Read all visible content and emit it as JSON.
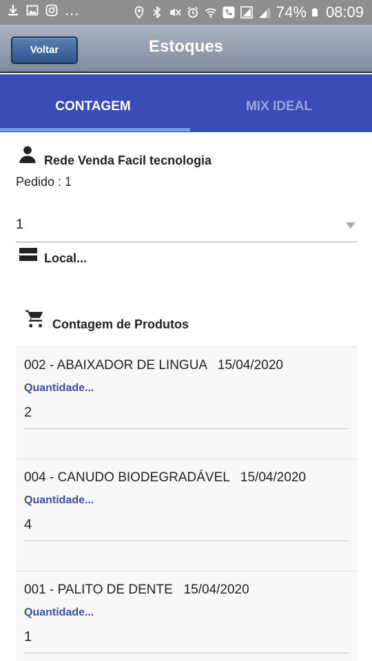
{
  "status_bar": {
    "battery": "74%",
    "time": "08:09",
    "overflow": "...",
    "left_icons": [
      "download-icon",
      "image-icon",
      "instagram-icon"
    ],
    "right_icons": [
      "location-icon",
      "bluetooth-icon",
      "mute-icon",
      "alarm-icon",
      "wifi-icon",
      "call-icon",
      "data-icon",
      "signal-icon",
      "battery-icon"
    ]
  },
  "header": {
    "back_label": "Voltar",
    "title": "Estoques"
  },
  "tabs": [
    {
      "label": "CONTAGEM",
      "active": true
    },
    {
      "label": "MIX IDEAL",
      "active": false
    }
  ],
  "customer": {
    "name": "Rede Venda Facil tecnologia",
    "order": "Pedido : 1"
  },
  "select": {
    "value": "1"
  },
  "local": {
    "placeholder": "Local..."
  },
  "section": {
    "title": "Contagem de Produtos"
  },
  "products": [
    {
      "title": "002 - ABAIXADOR DE LINGUA   15/04/2020",
      "quantity_label": "Quantidade...",
      "quantity": "2"
    },
    {
      "title": "004 - CANUDO BIODEGRADÁVEL   15/04/2020",
      "quantity_label": "Quantidade...",
      "quantity": "4"
    },
    {
      "title": "001 - PALITO DE DENTE   15/04/2020",
      "quantity_label": "Quantidade...",
      "quantity": "1"
    }
  ],
  "colors": {
    "tab_bar": "#3a4cb8",
    "tab_indicator": "#6aa0ea",
    "quantity_label": "#3a4ca0",
    "back_button": "#2f5590"
  }
}
